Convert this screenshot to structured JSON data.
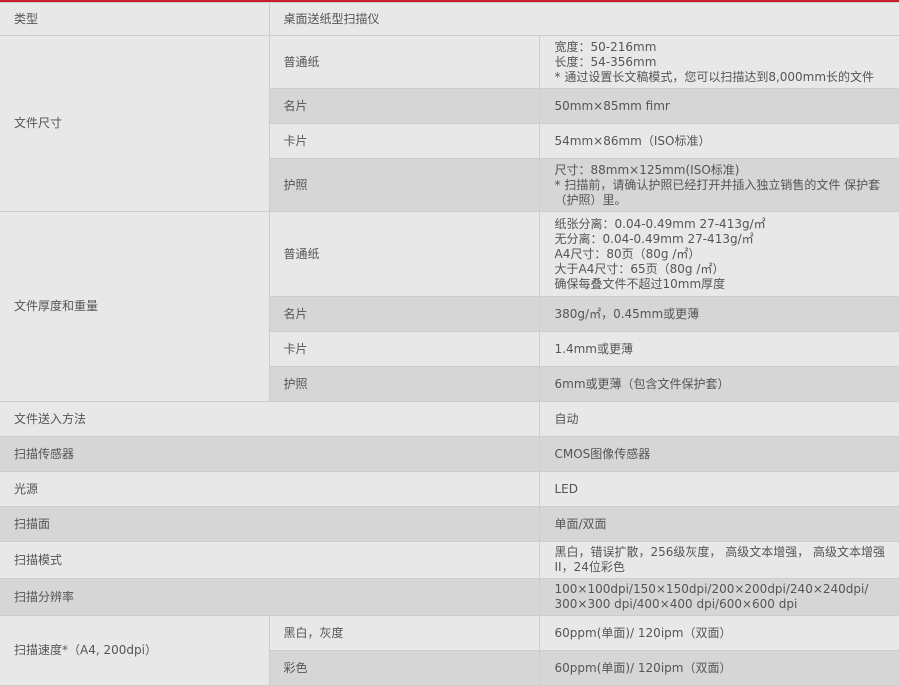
{
  "rows": {
    "type": {
      "label": "类型",
      "value": "桌面送纸型扫描仪"
    },
    "size": {
      "label": "文件尺寸",
      "plain": {
        "label": "普通纸",
        "value": "宽度：50-216mm\n长度：54-356mm\n* 通过设置长文稿模式，您可以扫描达到8,000mm长的文件"
      },
      "card": {
        "label": "名片",
        "value": "50mm×85mm fimr"
      },
      "card2": {
        "label": "卡片",
        "value": "54mm×86mm（ISO标准）"
      },
      "passport": {
        "label": "护照",
        "value": "尺寸：88mm×125mm(ISO标准)\n* 扫描前，请确认护照已经打开并插入独立销售的文件 保护套（护照）里。"
      }
    },
    "thick": {
      "label": "文件厚度和重量",
      "plain": {
        "label": "普通纸",
        "value": "纸张分离：0.04-0.49mm 27-413g/㎡\n无分离：0.04-0.49mm 27-413g/㎡\nA4尺寸：80页（80g /㎡）\n大于A4尺寸：65页（80g /㎡）\n确保每叠文件不超过10mm厚度"
      },
      "card": {
        "label": "名片",
        "value": "380g/㎡，0.45mm或更薄"
      },
      "card2": {
        "label": "卡片",
        "value": "1.4mm或更薄"
      },
      "passport": {
        "label": "护照",
        "value": "6mm或更薄（包含文件保护套）"
      }
    },
    "feed": {
      "label": "文件送入方法",
      "value": "自动"
    },
    "sensor": {
      "label": "扫描传感器",
      "value": "CMOS图像传感器"
    },
    "light": {
      "label": "光源",
      "value": "LED"
    },
    "side": {
      "label": "扫描面",
      "value": "单面/双面"
    },
    "mode": {
      "label": "扫描模式",
      "value": "黑白，错误扩散，256级灰度， 高级文本增强， 高级文本增强II，24位彩色"
    },
    "res": {
      "label": "扫描分辨率",
      "value": "100×100dpi/150×150dpi/200×200dpi/240×240dpi/ 300×300 dpi/400×400 dpi/600×600 dpi"
    },
    "speed": {
      "label": "扫描速度*（A4, 200dpi）",
      "bw": {
        "label": "黑白，灰度",
        "value": "60ppm(单面)/ 120ipm（双面）"
      },
      "color": {
        "label": "彩色",
        "value": "60ppm(单面)/ 120ipm（双面）"
      }
    }
  }
}
